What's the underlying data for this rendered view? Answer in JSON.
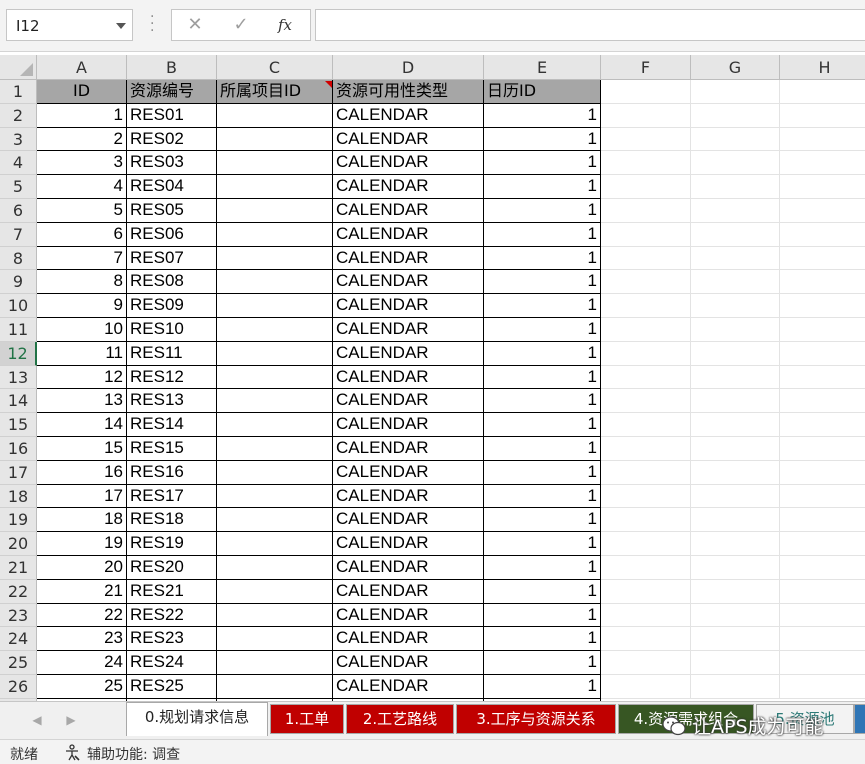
{
  "formula_bar": {
    "name_box": "I12",
    "cancel_symbol": "✕",
    "enter_symbol": "✓",
    "fx_label": "fx",
    "formula_value": ""
  },
  "grid": {
    "column_headers": [
      "A",
      "B",
      "C",
      "D",
      "E",
      "F",
      "G",
      "H"
    ],
    "header_row": [
      "ID",
      "资源编号",
      "所属项目ID",
      "资源可用性类型",
      "日历ID"
    ],
    "rows": [
      {
        "num": "2",
        "id": "1",
        "code": "RES01",
        "project": "",
        "type": "CALENDAR",
        "calendar": "1"
      },
      {
        "num": "3",
        "id": "2",
        "code": "RES02",
        "project": "",
        "type": "CALENDAR",
        "calendar": "1"
      },
      {
        "num": "4",
        "id": "3",
        "code": "RES03",
        "project": "",
        "type": "CALENDAR",
        "calendar": "1"
      },
      {
        "num": "5",
        "id": "4",
        "code": "RES04",
        "project": "",
        "type": "CALENDAR",
        "calendar": "1"
      },
      {
        "num": "6",
        "id": "5",
        "code": "RES05",
        "project": "",
        "type": "CALENDAR",
        "calendar": "1"
      },
      {
        "num": "7",
        "id": "6",
        "code": "RES06",
        "project": "",
        "type": "CALENDAR",
        "calendar": "1"
      },
      {
        "num": "8",
        "id": "7",
        "code": "RES07",
        "project": "",
        "type": "CALENDAR",
        "calendar": "1"
      },
      {
        "num": "9",
        "id": "8",
        "code": "RES08",
        "project": "",
        "type": "CALENDAR",
        "calendar": "1"
      },
      {
        "num": "10",
        "id": "9",
        "code": "RES09",
        "project": "",
        "type": "CALENDAR",
        "calendar": "1"
      },
      {
        "num": "11",
        "id": "10",
        "code": "RES10",
        "project": "",
        "type": "CALENDAR",
        "calendar": "1"
      },
      {
        "num": "12",
        "id": "11",
        "code": "RES11",
        "project": "",
        "type": "CALENDAR",
        "calendar": "1"
      },
      {
        "num": "13",
        "id": "12",
        "code": "RES12",
        "project": "",
        "type": "CALENDAR",
        "calendar": "1"
      },
      {
        "num": "14",
        "id": "13",
        "code": "RES13",
        "project": "",
        "type": "CALENDAR",
        "calendar": "1"
      },
      {
        "num": "15",
        "id": "14",
        "code": "RES14",
        "project": "",
        "type": "CALENDAR",
        "calendar": "1"
      },
      {
        "num": "16",
        "id": "15",
        "code": "RES15",
        "project": "",
        "type": "CALENDAR",
        "calendar": "1"
      },
      {
        "num": "17",
        "id": "16",
        "code": "RES16",
        "project": "",
        "type": "CALENDAR",
        "calendar": "1"
      },
      {
        "num": "18",
        "id": "17",
        "code": "RES17",
        "project": "",
        "type": "CALENDAR",
        "calendar": "1"
      },
      {
        "num": "19",
        "id": "18",
        "code": "RES18",
        "project": "",
        "type": "CALENDAR",
        "calendar": "1"
      },
      {
        "num": "20",
        "id": "19",
        "code": "RES19",
        "project": "",
        "type": "CALENDAR",
        "calendar": "1"
      },
      {
        "num": "21",
        "id": "20",
        "code": "RES20",
        "project": "",
        "type": "CALENDAR",
        "calendar": "1"
      },
      {
        "num": "22",
        "id": "21",
        "code": "RES21",
        "project": "",
        "type": "CALENDAR",
        "calendar": "1"
      },
      {
        "num": "23",
        "id": "22",
        "code": "RES22",
        "project": "",
        "type": "CALENDAR",
        "calendar": "1"
      },
      {
        "num": "24",
        "id": "23",
        "code": "RES23",
        "project": "",
        "type": "CALENDAR",
        "calendar": "1"
      },
      {
        "num": "25",
        "id": "24",
        "code": "RES24",
        "project": "",
        "type": "CALENDAR",
        "calendar": "1"
      },
      {
        "num": "26",
        "id": "25",
        "code": "RES25",
        "project": "",
        "type": "CALENDAR",
        "calendar": "1"
      }
    ],
    "active_row": "12",
    "colors": {
      "header_fill": "#a6a6a6",
      "active_row_header": "#217346",
      "comment_marker": "#d00000"
    }
  },
  "sheet_tabs": [
    {
      "label": "0.规划请求信息",
      "style": "active"
    },
    {
      "label": "1.工单",
      "style": "red"
    },
    {
      "label": "2.工艺路线",
      "style": "red"
    },
    {
      "label": "3.工序与资源关系",
      "style": "red"
    },
    {
      "label": "4.资源需求组合",
      "style": "green"
    },
    {
      "label": "5.资源池",
      "style": "teal"
    },
    {
      "label": "",
      "style": "blue"
    }
  ],
  "tab_colors": {
    "red": "#c00000",
    "green": "#375623",
    "blue": "#2f75b5",
    "teal_text": "#2d7a77"
  },
  "status_bar": {
    "ready": "就绪",
    "accessibility": "辅助功能: 调查"
  },
  "watermark": {
    "text": "让APS成为可能"
  }
}
